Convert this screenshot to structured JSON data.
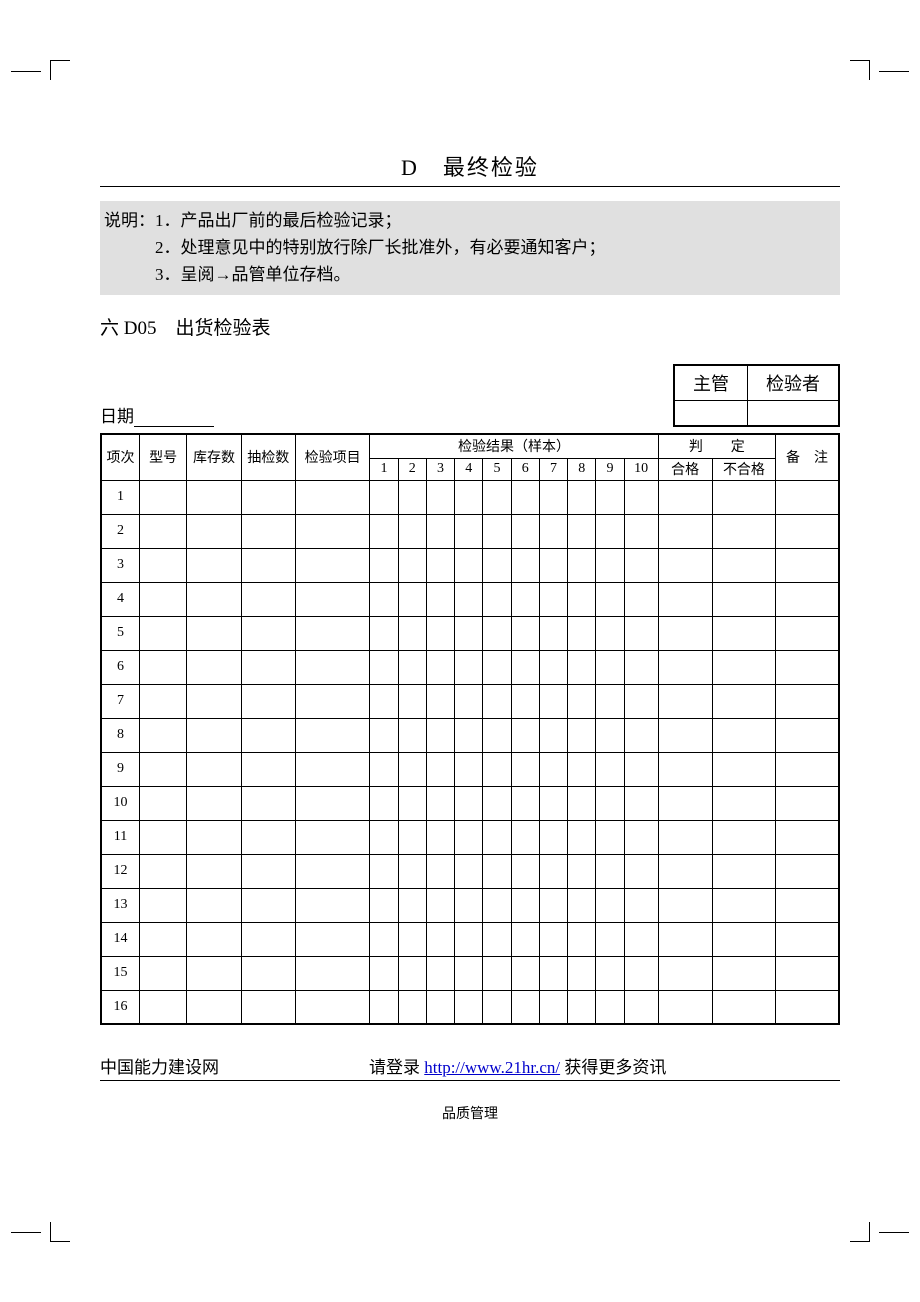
{
  "title": "D　最终检验",
  "instructions": {
    "label": "说明：",
    "lines": [
      "1．产品出厂前的最后检验记录；",
      "2．处理意见中的特别放行除厂长批准外，有必要通知客户；",
      "3．呈阅→品管单位存档。"
    ]
  },
  "subtitle": "六 D05　出货检验表",
  "date_label": "日期",
  "sign_table": {
    "supervisor": "主管",
    "inspector": "检验者"
  },
  "table": {
    "headers": {
      "idx": "项次",
      "model": "型号",
      "stock": "库存数",
      "sample": "抽检数",
      "item": "检验项目",
      "result_group": "检验结果（样本）",
      "result_cols": [
        "1",
        "2",
        "3",
        "4",
        "5",
        "6",
        "7",
        "8",
        "9",
        "10"
      ],
      "judge_group": "判　　定",
      "pass": "合格",
      "fail": "不合格",
      "note": "备　注"
    },
    "rows": [
      "1",
      "2",
      "3",
      "4",
      "5",
      "6",
      "7",
      "8",
      "9",
      "10",
      "11",
      "12",
      "13",
      "14",
      "15",
      "16"
    ]
  },
  "footer": {
    "org": "中国能力建设网",
    "login_prefix": "请登录 ",
    "url": "http://www.21hr.cn/",
    "login_suffix": " 获得更多资讯"
  },
  "page_footer": "品质管理"
}
